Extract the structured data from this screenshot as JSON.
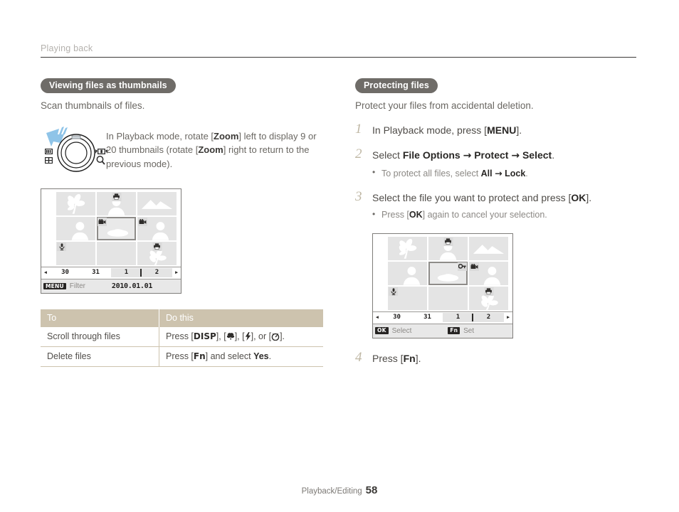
{
  "runhead": {
    "title": "Playing back"
  },
  "left": {
    "section_title": "Viewing files as thumbnails",
    "lead": "Scan thumbnails of files.",
    "dial_text_1": "In Playback mode, rotate [",
    "dial_zoom_1": "Zoom",
    "dial_text_2": "] left to display 9 or 20 thumbnails (rotate [",
    "dial_zoom_2": "Zoom",
    "dial_text_3": "] right to return to the previous mode).",
    "table": {
      "headers": [
        "To",
        "Do this"
      ],
      "rows": [
        {
          "to": "Scroll through files",
          "do_prefix": "Press [",
          "keys": [
            "DISP",
            "macro",
            "flash",
            "timer"
          ],
          "do_suffix": "]."
        },
        {
          "to": "Delete files",
          "do_prefix": "Press [",
          "key": "Fn",
          "do_mid": "] and select ",
          "do_bold": "Yes",
          "do_suffix": "."
        }
      ]
    },
    "screen": {
      "nav": {
        "left_arrow": "◂",
        "right_arrow": "▸",
        "segments": [
          "30",
          "31",
          "1",
          "2"
        ]
      },
      "bottom": {
        "menu_key": "MENU",
        "menu_label": "Filter",
        "date": "2010.01.01"
      }
    }
  },
  "right": {
    "section_title": "Protecting files",
    "lead": "Protect your files from accidental deletion.",
    "steps": [
      {
        "num": "1",
        "pre": "In Playback mode, press [",
        "key": "MENU",
        "post": "]."
      },
      {
        "num": "2",
        "pre": "Select ",
        "b1": "File Options",
        "arrow1": "→",
        "b2": "Protect",
        "arrow2": "→",
        "b3": "Select",
        "post": ".",
        "sub": {
          "pre": "To protect all files, select ",
          "b1": "All",
          "arrow": "→",
          "b2": "Lock",
          "post": "."
        }
      },
      {
        "num": "3",
        "pre": "Select the file you want to protect and press [",
        "key": "OK",
        "post": "].",
        "sub": {
          "pre": "Press [",
          "key": "OK",
          "post": "] again to cancel your selection."
        }
      },
      {
        "num": "4",
        "pre": "Press [",
        "key": "Fn",
        "post": "]."
      }
    ],
    "screen": {
      "nav": {
        "left_arrow": "◂",
        "right_arrow": "▸",
        "segments": [
          "30",
          "31",
          "1",
          "2"
        ]
      },
      "bottom": {
        "ok_key": "OK",
        "ok_label": "Select",
        "fn_key": "Fn",
        "fn_label": "Set"
      }
    }
  },
  "footer": {
    "label": "Playback/Editing",
    "page": "58"
  },
  "colors": {
    "badge_bg": "#6f6c68",
    "table_header_bg": "#cdc3ae",
    "rule": "#3c3a38",
    "step_number": "#bfb7a4",
    "thumb_bg": "#e4e4e4"
  }
}
